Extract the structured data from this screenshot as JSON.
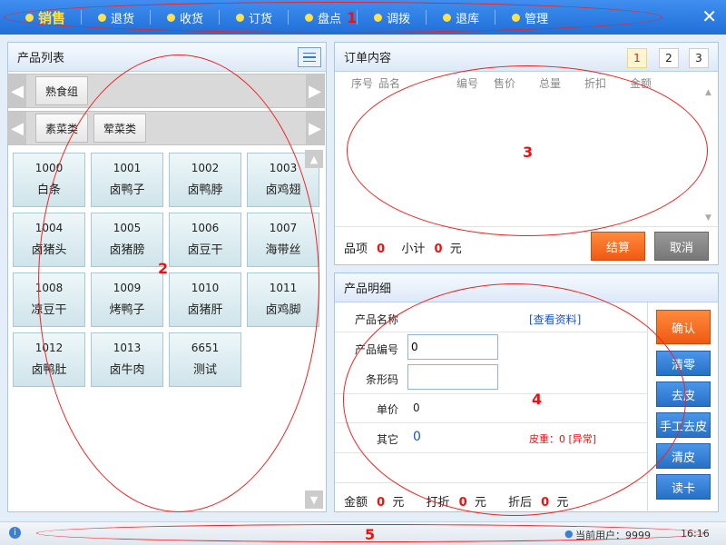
{
  "topbar": {
    "items": [
      {
        "label": "销售",
        "icon": "sale-icon"
      },
      {
        "label": "退货",
        "icon": "return-icon"
      },
      {
        "label": "收货",
        "icon": "receive-icon"
      },
      {
        "label": "订货",
        "icon": "order-icon"
      },
      {
        "label": "盘点",
        "icon": "inventory-icon"
      },
      {
        "label": "调拨",
        "icon": "transfer-icon"
      },
      {
        "label": "退库",
        "icon": "return-stock-icon"
      },
      {
        "label": "管理",
        "icon": "gear-icon"
      }
    ],
    "close": "✕"
  },
  "product_list": {
    "title": "产品列表",
    "category_row1": [
      "熟食组"
    ],
    "category_row2": [
      "素菜类",
      "荤菜类"
    ],
    "products": [
      {
        "code": "1000",
        "name": "白条"
      },
      {
        "code": "1001",
        "name": "卤鸭子"
      },
      {
        "code": "1002",
        "name": "卤鸭脖"
      },
      {
        "code": "1003",
        "name": "卤鸡翅"
      },
      {
        "code": "1004",
        "name": "卤猪头"
      },
      {
        "code": "1005",
        "name": "卤猪膀"
      },
      {
        "code": "1006",
        "name": "卤豆干"
      },
      {
        "code": "1007",
        "name": "海带丝"
      },
      {
        "code": "1008",
        "name": "凉豆干"
      },
      {
        "code": "1009",
        "name": "烤鸭子"
      },
      {
        "code": "1010",
        "name": "卤猪肝"
      },
      {
        "code": "1011",
        "name": "卤鸡脚"
      },
      {
        "code": "1012",
        "name": "卤鸭肚"
      },
      {
        "code": "1013",
        "name": "卤牛肉"
      },
      {
        "code": "6651",
        "name": "测试"
      }
    ]
  },
  "order": {
    "title": "订单内容",
    "pages": [
      "1",
      "2",
      "3"
    ],
    "columns": [
      "序号",
      "品名",
      "编号",
      "售价",
      "总量",
      "折扣",
      "金额"
    ],
    "items_label": "品项",
    "items_value": "0",
    "subtotal_label": "小计",
    "subtotal_value": "0",
    "currency": "元",
    "checkout": "结算",
    "cancel": "取消"
  },
  "detail": {
    "title": "产品明细",
    "name_label": "产品名称",
    "view_link": "[查看资料]",
    "code_label": "产品编号",
    "code_value": "0",
    "barcode_label": "条形码",
    "barcode_value": "",
    "price_label": "单价",
    "price_value": "0",
    "other_label": "其它",
    "other_value": "0",
    "tare": "皮重：0 [异常]",
    "amount_label": "金额",
    "amount_value": "0",
    "discount_label": "打折",
    "discount_value": "0",
    "after_label": "折后",
    "after_value": "0",
    "currency": "元",
    "buttons": [
      "确认",
      "清零",
      "去皮",
      "手工去皮",
      "清皮",
      "读卡"
    ]
  },
  "status": {
    "user_label": "当前用户：9999",
    "time": "16:16"
  },
  "annotations": [
    "1",
    "2",
    "3",
    "4",
    "5"
  ]
}
